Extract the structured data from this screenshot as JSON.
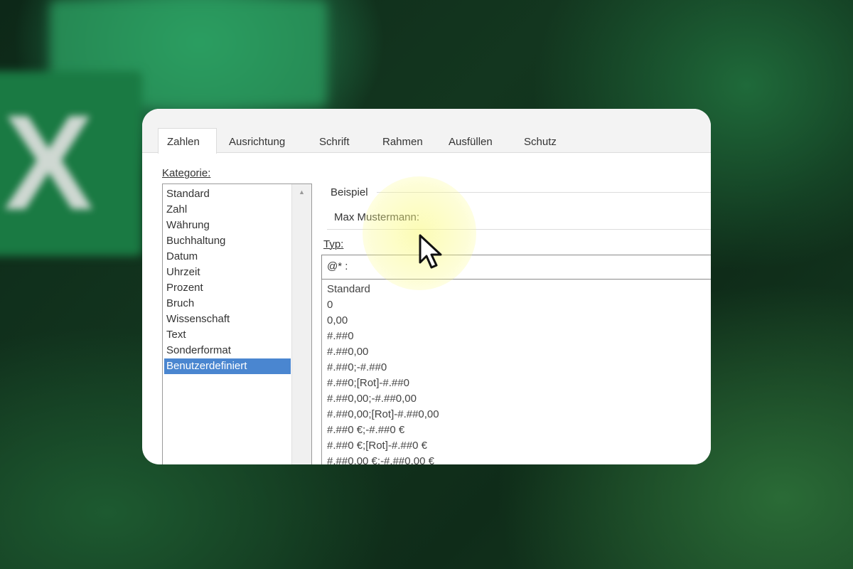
{
  "tabs": [
    "Zahlen",
    "Ausrichtung",
    "Schrift",
    "Rahmen",
    "Ausfüllen",
    "Schutz"
  ],
  "kategorie_label": "Kategorie:",
  "categories": [
    "Standard",
    "Zahl",
    "Währung",
    "Buchhaltung",
    "Datum",
    "Uhrzeit",
    "Prozent",
    "Bruch",
    "Wissenschaft",
    "Text",
    "Sonderformat",
    "Benutzerdefiniert"
  ],
  "selected_category": "Benutzerdefiniert",
  "beispiel_label": "Beispiel",
  "beispiel_value": "Max Mustermann:",
  "typ_label": "Typ:",
  "typ_value": "@* :",
  "formats": [
    "Standard",
    "0",
    "0,00",
    "#.##0",
    "#.##0,00",
    "#.##0;-#.##0",
    "#.##0;[Rot]-#.##0",
    "#.##0,00;-#.##0,00",
    "#.##0,00;[Rot]-#.##0,00",
    "#.##0 €;-#.##0 €",
    "#.##0 €;[Rot]-#.##0 €",
    "#.##0,00 €;-#.##0,00 €"
  ],
  "colors": {
    "selection": "#4a86d0",
    "highlight": "#f7f77a"
  }
}
